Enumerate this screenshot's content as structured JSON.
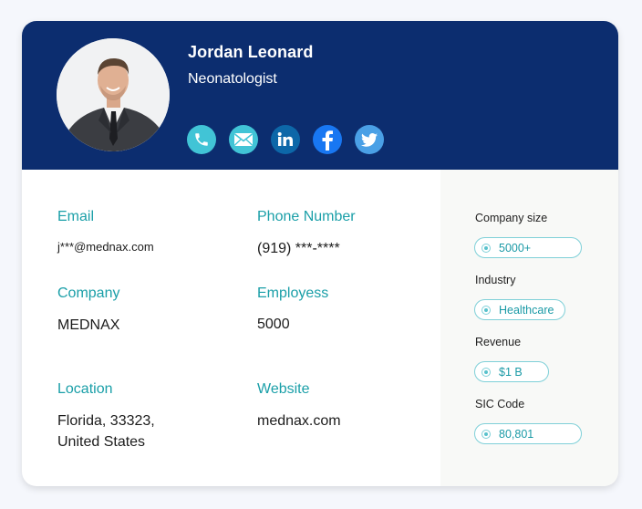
{
  "profile": {
    "name": "Jordan Leonard",
    "title": "Neonatologist",
    "avatar_alt": "Profile photo of man in suit",
    "socials": [
      {
        "name": "phone",
        "icon": "phone-icon"
      },
      {
        "name": "email",
        "icon": "email-icon"
      },
      {
        "name": "linkedin",
        "icon": "linkedin-icon"
      },
      {
        "name": "facebook",
        "icon": "facebook-icon"
      },
      {
        "name": "twitter",
        "icon": "twitter-icon"
      }
    ]
  },
  "details": {
    "email": {
      "label": "Email",
      "value": "j***@mednax.com"
    },
    "phone": {
      "label": "Phone Number",
      "value": "(919) ***-****"
    },
    "company": {
      "label": "Company",
      "value": "MEDNAX"
    },
    "employees": {
      "label": "Employess",
      "value": "5000"
    },
    "location": {
      "label": "Location",
      "value_line1": "Florida, 33323,",
      "value_line2": "United States"
    },
    "website": {
      "label": "Website",
      "value": "mednax.com"
    }
  },
  "sidebar": {
    "company_size": {
      "label": "Company size",
      "value": "5000+"
    },
    "industry": {
      "label": "Industry",
      "value": "Healthcare"
    },
    "revenue": {
      "label": "Revenue",
      "value": "$1 B"
    },
    "sic_code": {
      "label": "SIC Code",
      "value": "80,801"
    }
  },
  "colors": {
    "header_bg": "#0c2d6f",
    "accent_teal": "#1a9fa8",
    "pill_border": "#7fd0d8"
  }
}
